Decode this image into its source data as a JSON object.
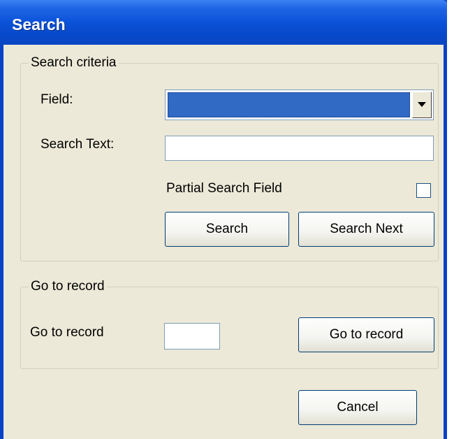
{
  "window": {
    "title": "Search"
  },
  "search_criteria": {
    "legend": "Search criteria",
    "field_label": "Field:",
    "field_value": "",
    "search_text_label": "Search Text:",
    "search_text_value": "",
    "partial_label": "Partial Search Field",
    "partial_checked": false,
    "search_button": "Search",
    "search_next_button": "Search Next"
  },
  "go_to_record": {
    "legend": "Go to record",
    "label": "Go to record",
    "value": "",
    "button": "Go to record"
  },
  "footer": {
    "cancel_button": "Cancel"
  }
}
